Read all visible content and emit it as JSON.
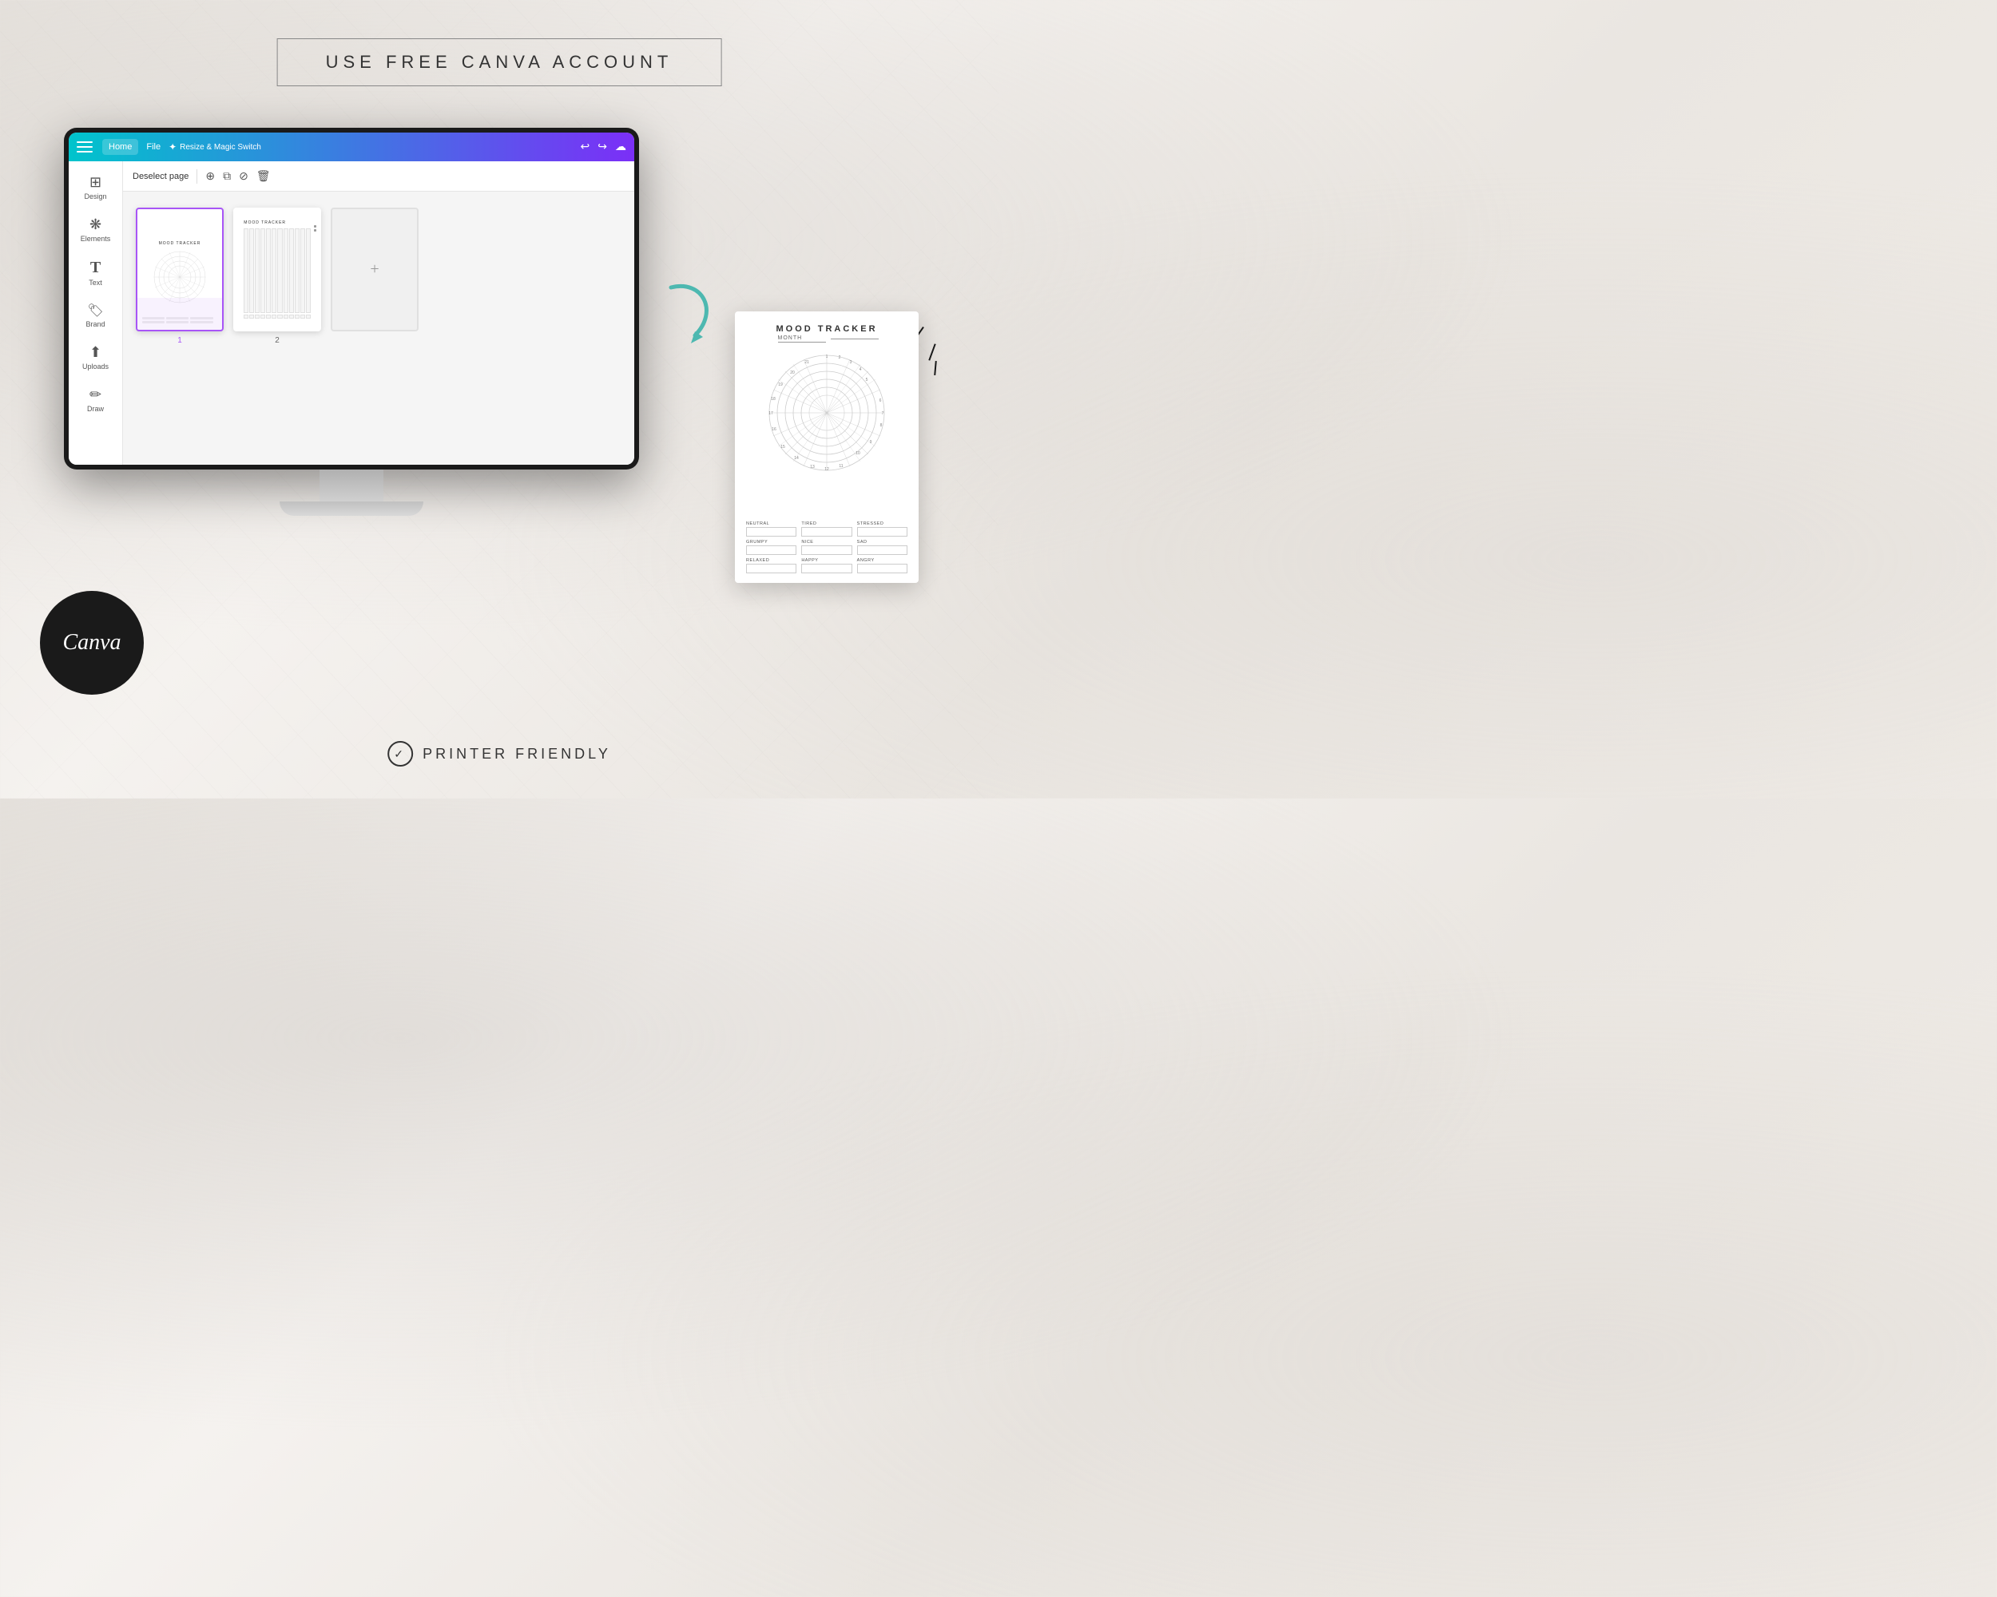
{
  "page": {
    "title": "USE FREE CANVA ACCOUNT",
    "bottom_text": "PRINTER FRIENDLY"
  },
  "topbar": {
    "home": "Home",
    "file": "File",
    "magic": "Resize & Magic Switch",
    "gradient_start": "#00c4cc",
    "gradient_end": "#7b2ff7"
  },
  "toolbar": {
    "deselect": "Deselect page"
  },
  "sidebar": {
    "items": [
      {
        "label": "Design",
        "icon": "⊞"
      },
      {
        "label": "Elements",
        "icon": "✦"
      },
      {
        "label": "Text",
        "icon": "T"
      },
      {
        "label": "Brand",
        "icon": "🏷"
      },
      {
        "label": "Uploads",
        "icon": "↑"
      },
      {
        "label": "Draw",
        "icon": "✏"
      }
    ]
  },
  "pages": [
    {
      "num": "1",
      "selected": true,
      "title": "MOOD TRACKER"
    },
    {
      "num": "2",
      "selected": false,
      "title": "MOOD TRACKER"
    }
  ],
  "mood_paper": {
    "title": "MOOD TRACKER",
    "month_label": "MONTH",
    "legend": [
      {
        "label": "NEUTRAL"
      },
      {
        "label": "TIRED"
      },
      {
        "label": "STRESSED"
      },
      {
        "label": "GRUMPY"
      },
      {
        "label": "NICE"
      },
      {
        "label": "SAD"
      },
      {
        "label": "RELAXED"
      },
      {
        "label": "HAPPY"
      },
      {
        "label": "ANGRY"
      }
    ]
  },
  "canva_logo": "Canva"
}
